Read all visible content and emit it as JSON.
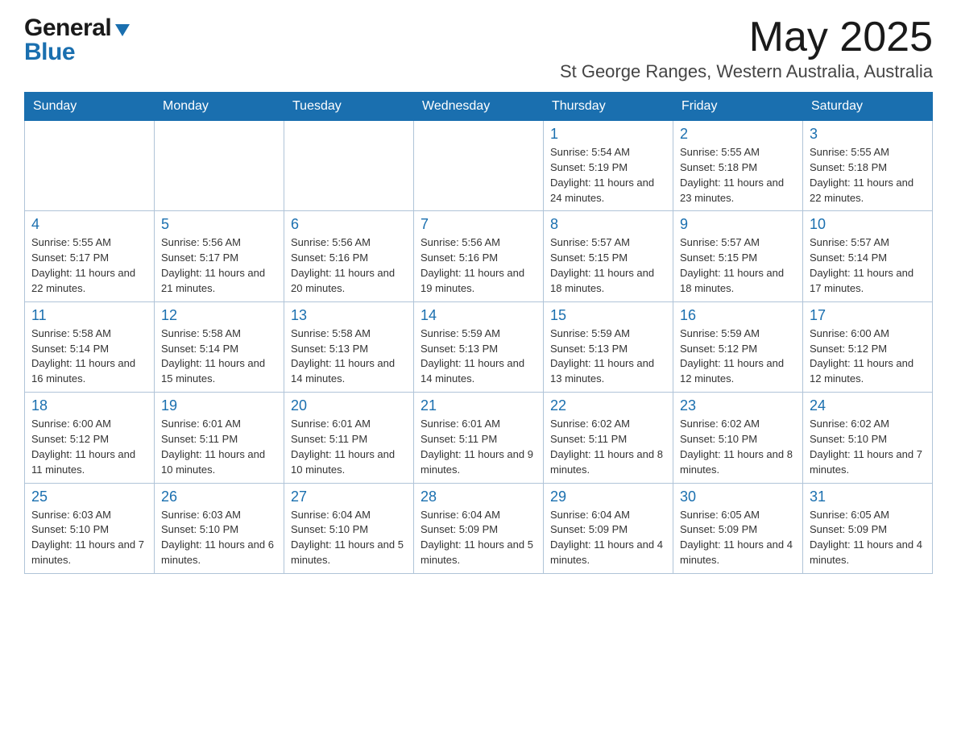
{
  "header": {
    "logo_general": "General",
    "logo_blue": "Blue",
    "month_year": "May 2025",
    "location": "St George Ranges, Western Australia, Australia"
  },
  "days_of_week": [
    "Sunday",
    "Monday",
    "Tuesday",
    "Wednesday",
    "Thursday",
    "Friday",
    "Saturday"
  ],
  "weeks": [
    [
      {
        "day": "",
        "info": ""
      },
      {
        "day": "",
        "info": ""
      },
      {
        "day": "",
        "info": ""
      },
      {
        "day": "",
        "info": ""
      },
      {
        "day": "1",
        "info": "Sunrise: 5:54 AM\nSunset: 5:19 PM\nDaylight: 11 hours and 24 minutes."
      },
      {
        "day": "2",
        "info": "Sunrise: 5:55 AM\nSunset: 5:18 PM\nDaylight: 11 hours and 23 minutes."
      },
      {
        "day": "3",
        "info": "Sunrise: 5:55 AM\nSunset: 5:18 PM\nDaylight: 11 hours and 22 minutes."
      }
    ],
    [
      {
        "day": "4",
        "info": "Sunrise: 5:55 AM\nSunset: 5:17 PM\nDaylight: 11 hours and 22 minutes."
      },
      {
        "day": "5",
        "info": "Sunrise: 5:56 AM\nSunset: 5:17 PM\nDaylight: 11 hours and 21 minutes."
      },
      {
        "day": "6",
        "info": "Sunrise: 5:56 AM\nSunset: 5:16 PM\nDaylight: 11 hours and 20 minutes."
      },
      {
        "day": "7",
        "info": "Sunrise: 5:56 AM\nSunset: 5:16 PM\nDaylight: 11 hours and 19 minutes."
      },
      {
        "day": "8",
        "info": "Sunrise: 5:57 AM\nSunset: 5:15 PM\nDaylight: 11 hours and 18 minutes."
      },
      {
        "day": "9",
        "info": "Sunrise: 5:57 AM\nSunset: 5:15 PM\nDaylight: 11 hours and 18 minutes."
      },
      {
        "day": "10",
        "info": "Sunrise: 5:57 AM\nSunset: 5:14 PM\nDaylight: 11 hours and 17 minutes."
      }
    ],
    [
      {
        "day": "11",
        "info": "Sunrise: 5:58 AM\nSunset: 5:14 PM\nDaylight: 11 hours and 16 minutes."
      },
      {
        "day": "12",
        "info": "Sunrise: 5:58 AM\nSunset: 5:14 PM\nDaylight: 11 hours and 15 minutes."
      },
      {
        "day": "13",
        "info": "Sunrise: 5:58 AM\nSunset: 5:13 PM\nDaylight: 11 hours and 14 minutes."
      },
      {
        "day": "14",
        "info": "Sunrise: 5:59 AM\nSunset: 5:13 PM\nDaylight: 11 hours and 14 minutes."
      },
      {
        "day": "15",
        "info": "Sunrise: 5:59 AM\nSunset: 5:13 PM\nDaylight: 11 hours and 13 minutes."
      },
      {
        "day": "16",
        "info": "Sunrise: 5:59 AM\nSunset: 5:12 PM\nDaylight: 11 hours and 12 minutes."
      },
      {
        "day": "17",
        "info": "Sunrise: 6:00 AM\nSunset: 5:12 PM\nDaylight: 11 hours and 12 minutes."
      }
    ],
    [
      {
        "day": "18",
        "info": "Sunrise: 6:00 AM\nSunset: 5:12 PM\nDaylight: 11 hours and 11 minutes."
      },
      {
        "day": "19",
        "info": "Sunrise: 6:01 AM\nSunset: 5:11 PM\nDaylight: 11 hours and 10 minutes."
      },
      {
        "day": "20",
        "info": "Sunrise: 6:01 AM\nSunset: 5:11 PM\nDaylight: 11 hours and 10 minutes."
      },
      {
        "day": "21",
        "info": "Sunrise: 6:01 AM\nSunset: 5:11 PM\nDaylight: 11 hours and 9 minutes."
      },
      {
        "day": "22",
        "info": "Sunrise: 6:02 AM\nSunset: 5:11 PM\nDaylight: 11 hours and 8 minutes."
      },
      {
        "day": "23",
        "info": "Sunrise: 6:02 AM\nSunset: 5:10 PM\nDaylight: 11 hours and 8 minutes."
      },
      {
        "day": "24",
        "info": "Sunrise: 6:02 AM\nSunset: 5:10 PM\nDaylight: 11 hours and 7 minutes."
      }
    ],
    [
      {
        "day": "25",
        "info": "Sunrise: 6:03 AM\nSunset: 5:10 PM\nDaylight: 11 hours and 7 minutes."
      },
      {
        "day": "26",
        "info": "Sunrise: 6:03 AM\nSunset: 5:10 PM\nDaylight: 11 hours and 6 minutes."
      },
      {
        "day": "27",
        "info": "Sunrise: 6:04 AM\nSunset: 5:10 PM\nDaylight: 11 hours and 5 minutes."
      },
      {
        "day": "28",
        "info": "Sunrise: 6:04 AM\nSunset: 5:09 PM\nDaylight: 11 hours and 5 minutes."
      },
      {
        "day": "29",
        "info": "Sunrise: 6:04 AM\nSunset: 5:09 PM\nDaylight: 11 hours and 4 minutes."
      },
      {
        "day": "30",
        "info": "Sunrise: 6:05 AM\nSunset: 5:09 PM\nDaylight: 11 hours and 4 minutes."
      },
      {
        "day": "31",
        "info": "Sunrise: 6:05 AM\nSunset: 5:09 PM\nDaylight: 11 hours and 4 minutes."
      }
    ]
  ]
}
